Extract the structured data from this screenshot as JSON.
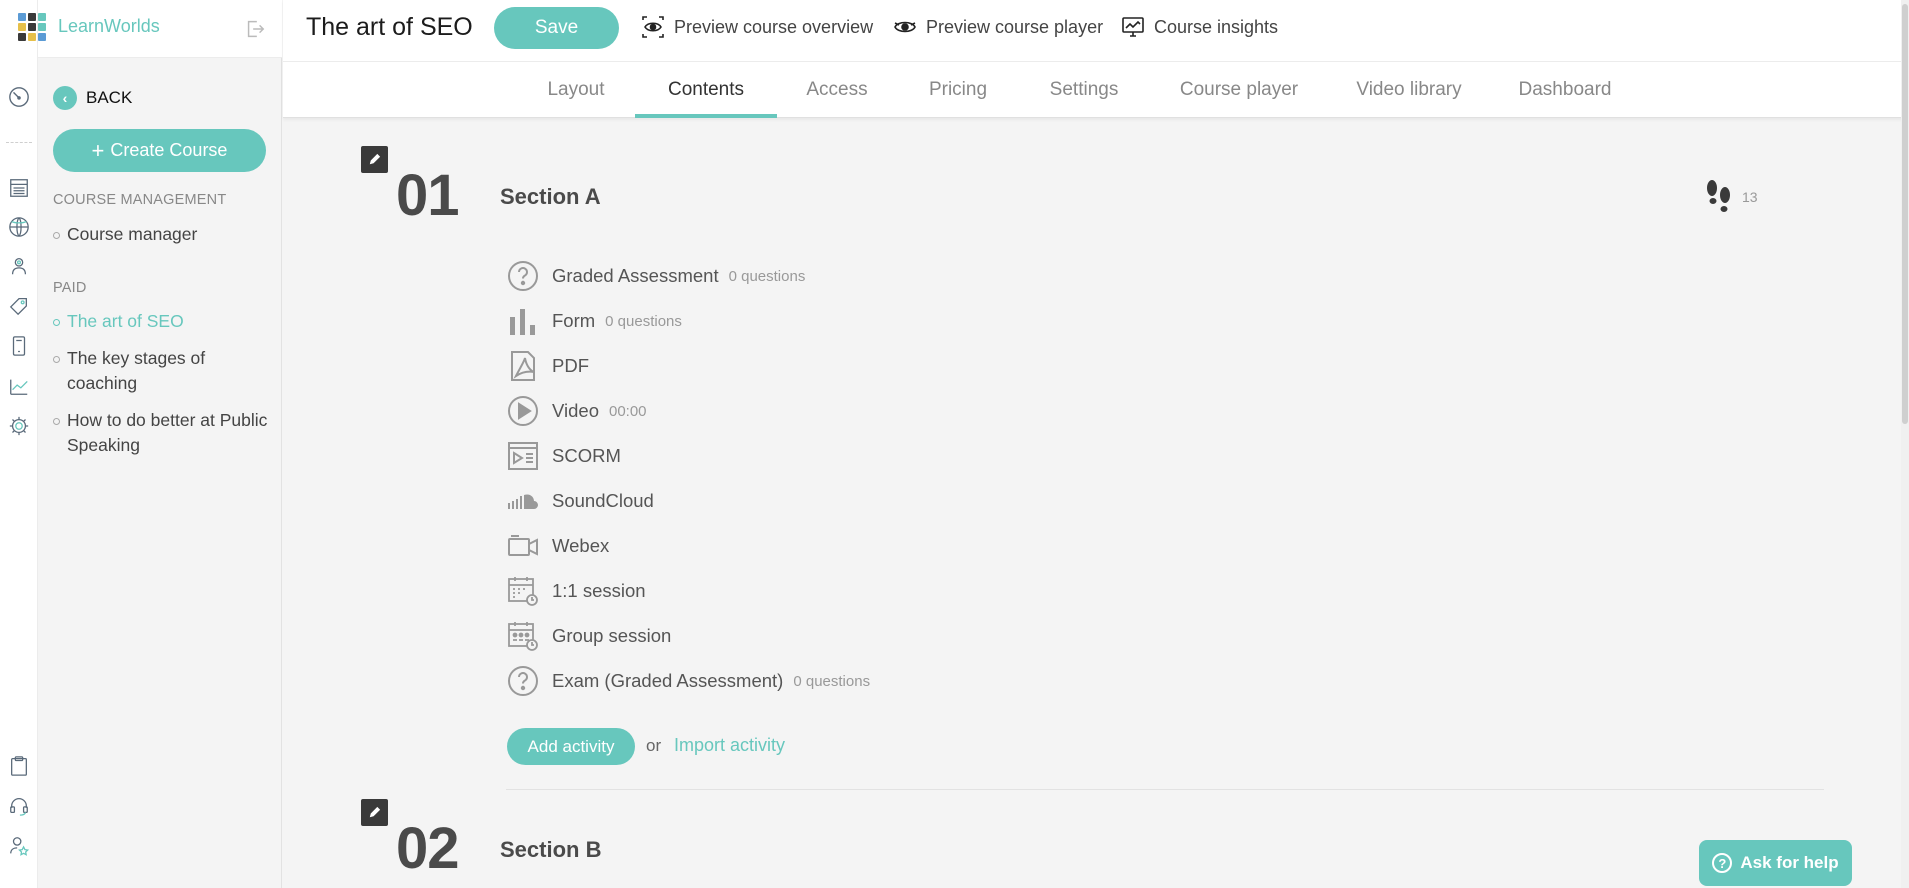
{
  "brand": {
    "name": "LearnWorlds",
    "logo_colors": [
      "#5b9bd5",
      "#3a3a3a",
      "#67c7bd",
      "#e6c04a",
      "#3a3a3a",
      "#67c7bd",
      "#3a3a3a",
      "#e6c04a",
      "#5b9bd5"
    ]
  },
  "colors": {
    "accent": "#67c7bd",
    "dark": "#3a3a3a"
  },
  "rail": {
    "icons": [
      "dashboard-gauge-icon",
      "courses-icon",
      "website-globe-icon",
      "users-icon",
      "sales-tag-icon",
      "mobile-app-icon",
      "reports-chart-icon",
      "settings-gear-icon",
      "clipboard-icon",
      "support-headset-icon",
      "user-star-icon"
    ]
  },
  "sidebar": {
    "back_label": "BACK",
    "create_label": "Create Course",
    "management_heading": "COURSE MANAGEMENT",
    "management_items": [
      "Course manager"
    ],
    "paid_heading": "PAID",
    "paid_items": [
      {
        "label": "The art of SEO",
        "active": true
      },
      {
        "label": "The key stages of coaching",
        "active": false
      },
      {
        "label": "How to do better at Public Speaking",
        "active": false
      }
    ]
  },
  "header": {
    "course_title": "The art of SEO",
    "save_label": "Save",
    "links": {
      "preview_overview": "Preview course overview",
      "preview_player": "Preview course player",
      "insights": "Course insights"
    },
    "tabs": [
      "Layout",
      "Contents",
      "Access",
      "Pricing",
      "Settings",
      "Course player",
      "Video library",
      "Dashboard"
    ],
    "active_tab": "Contents"
  },
  "sections": [
    {
      "number": "01",
      "title": "Section A",
      "steps": "13",
      "activities": [
        {
          "label": "Graded Assessment",
          "meta": "0 questions",
          "icon": "question-circle-icon"
        },
        {
          "label": "Form",
          "meta": "0 questions",
          "icon": "bar-chart-icon"
        },
        {
          "label": "PDF",
          "meta": "",
          "icon": "pdf-icon"
        },
        {
          "label": "Video",
          "meta": "00:00",
          "icon": "play-circle-icon"
        },
        {
          "label": "SCORM",
          "meta": "",
          "icon": "scorm-icon"
        },
        {
          "label": "SoundCloud",
          "meta": "",
          "icon": "soundcloud-icon"
        },
        {
          "label": "Webex",
          "meta": "",
          "icon": "video-camera-icon"
        },
        {
          "label": "1:1 session",
          "meta": "",
          "icon": "calendar-clock-icon"
        },
        {
          "label": "Group session",
          "meta": "",
          "icon": "calendar-group-icon"
        },
        {
          "label": "Exam (Graded Assessment)",
          "meta": "0 questions",
          "icon": "question-circle-icon"
        }
      ],
      "add_label": "Add activity",
      "or_label": "or",
      "import_label": "Import activity"
    },
    {
      "number": "02",
      "title": "Section B"
    }
  ],
  "help": {
    "label": "Ask for help"
  }
}
